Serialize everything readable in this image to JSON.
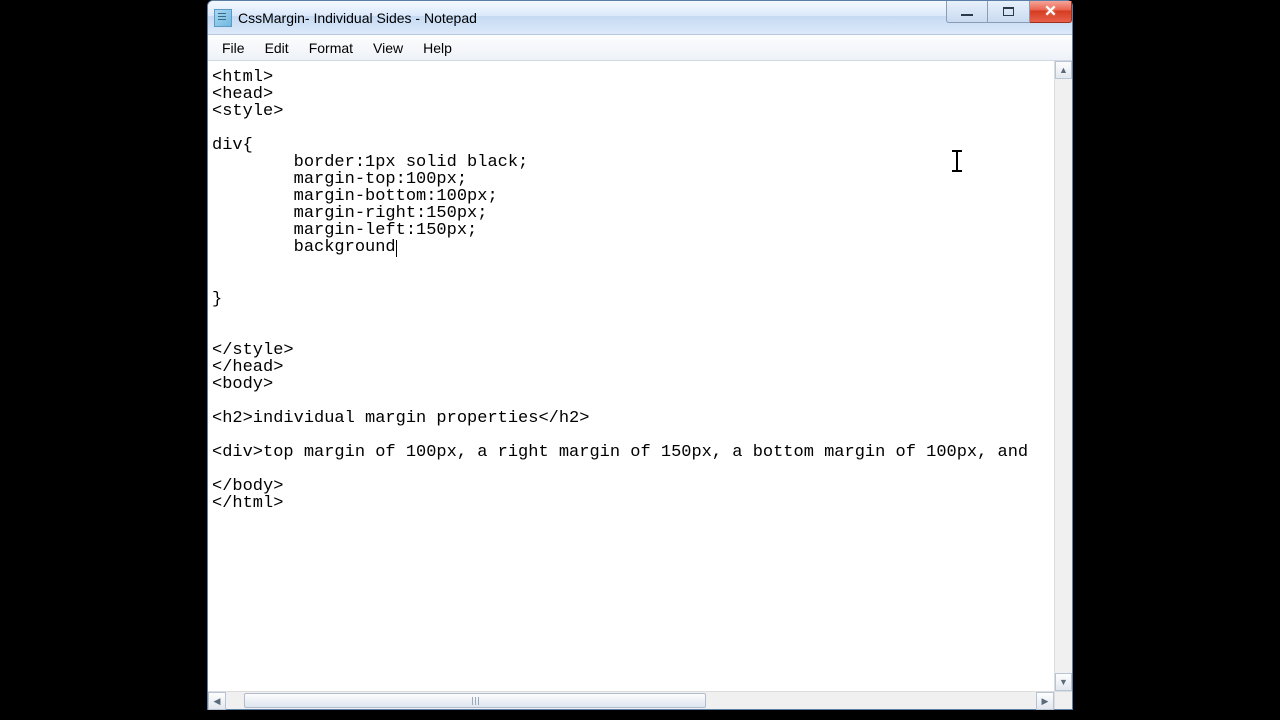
{
  "window": {
    "title": "CssMargin- Individual Sides - Notepad"
  },
  "menu": {
    "file": "File",
    "edit": "Edit",
    "format": "Format",
    "view": "View",
    "help": "Help"
  },
  "editor": {
    "lines": {
      "l1": "<html>",
      "l2": "<head>",
      "l3": "<style>",
      "l4": "",
      "l5": "div{",
      "l6": "        border:1px solid black;",
      "l7": "        margin-top:100px;",
      "l8": "        margin-bottom:100px;",
      "l9": "        margin-right:150px;",
      "l10": "        margin-left:150px;",
      "l11": "        background",
      "l12": "",
      "l13": "",
      "l14": "}",
      "l15": "",
      "l16": "",
      "l17": "</style>",
      "l18": "</head>",
      "l19": "<body>",
      "l20": "",
      "l21": "<h2>individual margin properties</h2>",
      "l22": "",
      "l23": "<div>top margin of 100px, a right margin of 150px, a bottom margin of 100px, and ",
      "l24": "",
      "l25": "</body>",
      "l26": "</html>"
    }
  },
  "icons": {
    "up": "▲",
    "down": "▼",
    "left": "◀",
    "right": "▶",
    "close": "✕"
  }
}
